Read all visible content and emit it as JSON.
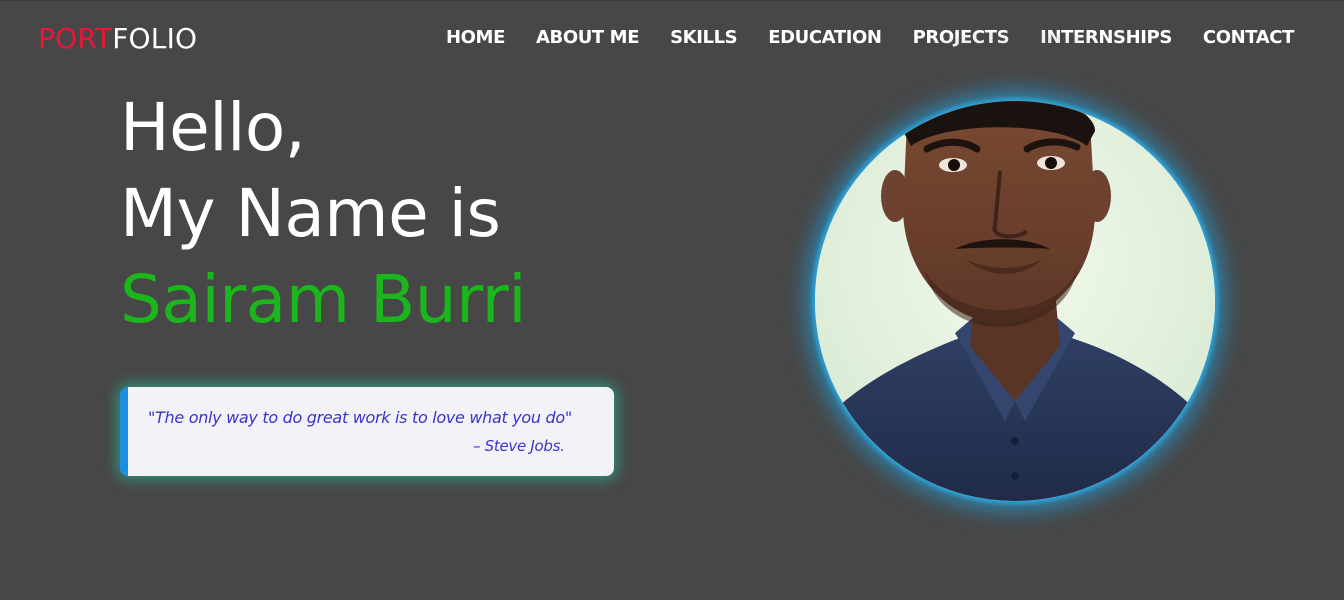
{
  "header": {
    "logo_accent": "PORT",
    "logo_rest": "FOLIO",
    "nav": [
      {
        "label": "HOME"
      },
      {
        "label": "ABOUT ME"
      },
      {
        "label": "SKILLS"
      },
      {
        "label": "EDUCATION"
      },
      {
        "label": "PROJECTS"
      },
      {
        "label": "INTERNSHIPS"
      },
      {
        "label": "CONTACT"
      }
    ]
  },
  "hero": {
    "greeting": "Hello,",
    "intro": "My Name is",
    "name": "Sairam Burri"
  },
  "quote": {
    "text": "\"The only way to do great work is to love what you do\"",
    "author": "– Steve Jobs."
  },
  "profile": {
    "photo_icon": "profile-photo"
  },
  "colors": {
    "background": "#474747",
    "logo_accent": "#e8173a",
    "name_green": "#1ab61c",
    "quote_text": "#3a35c9",
    "quote_border": "#1e8fe0",
    "photo_glow": "#1ea0e1"
  }
}
